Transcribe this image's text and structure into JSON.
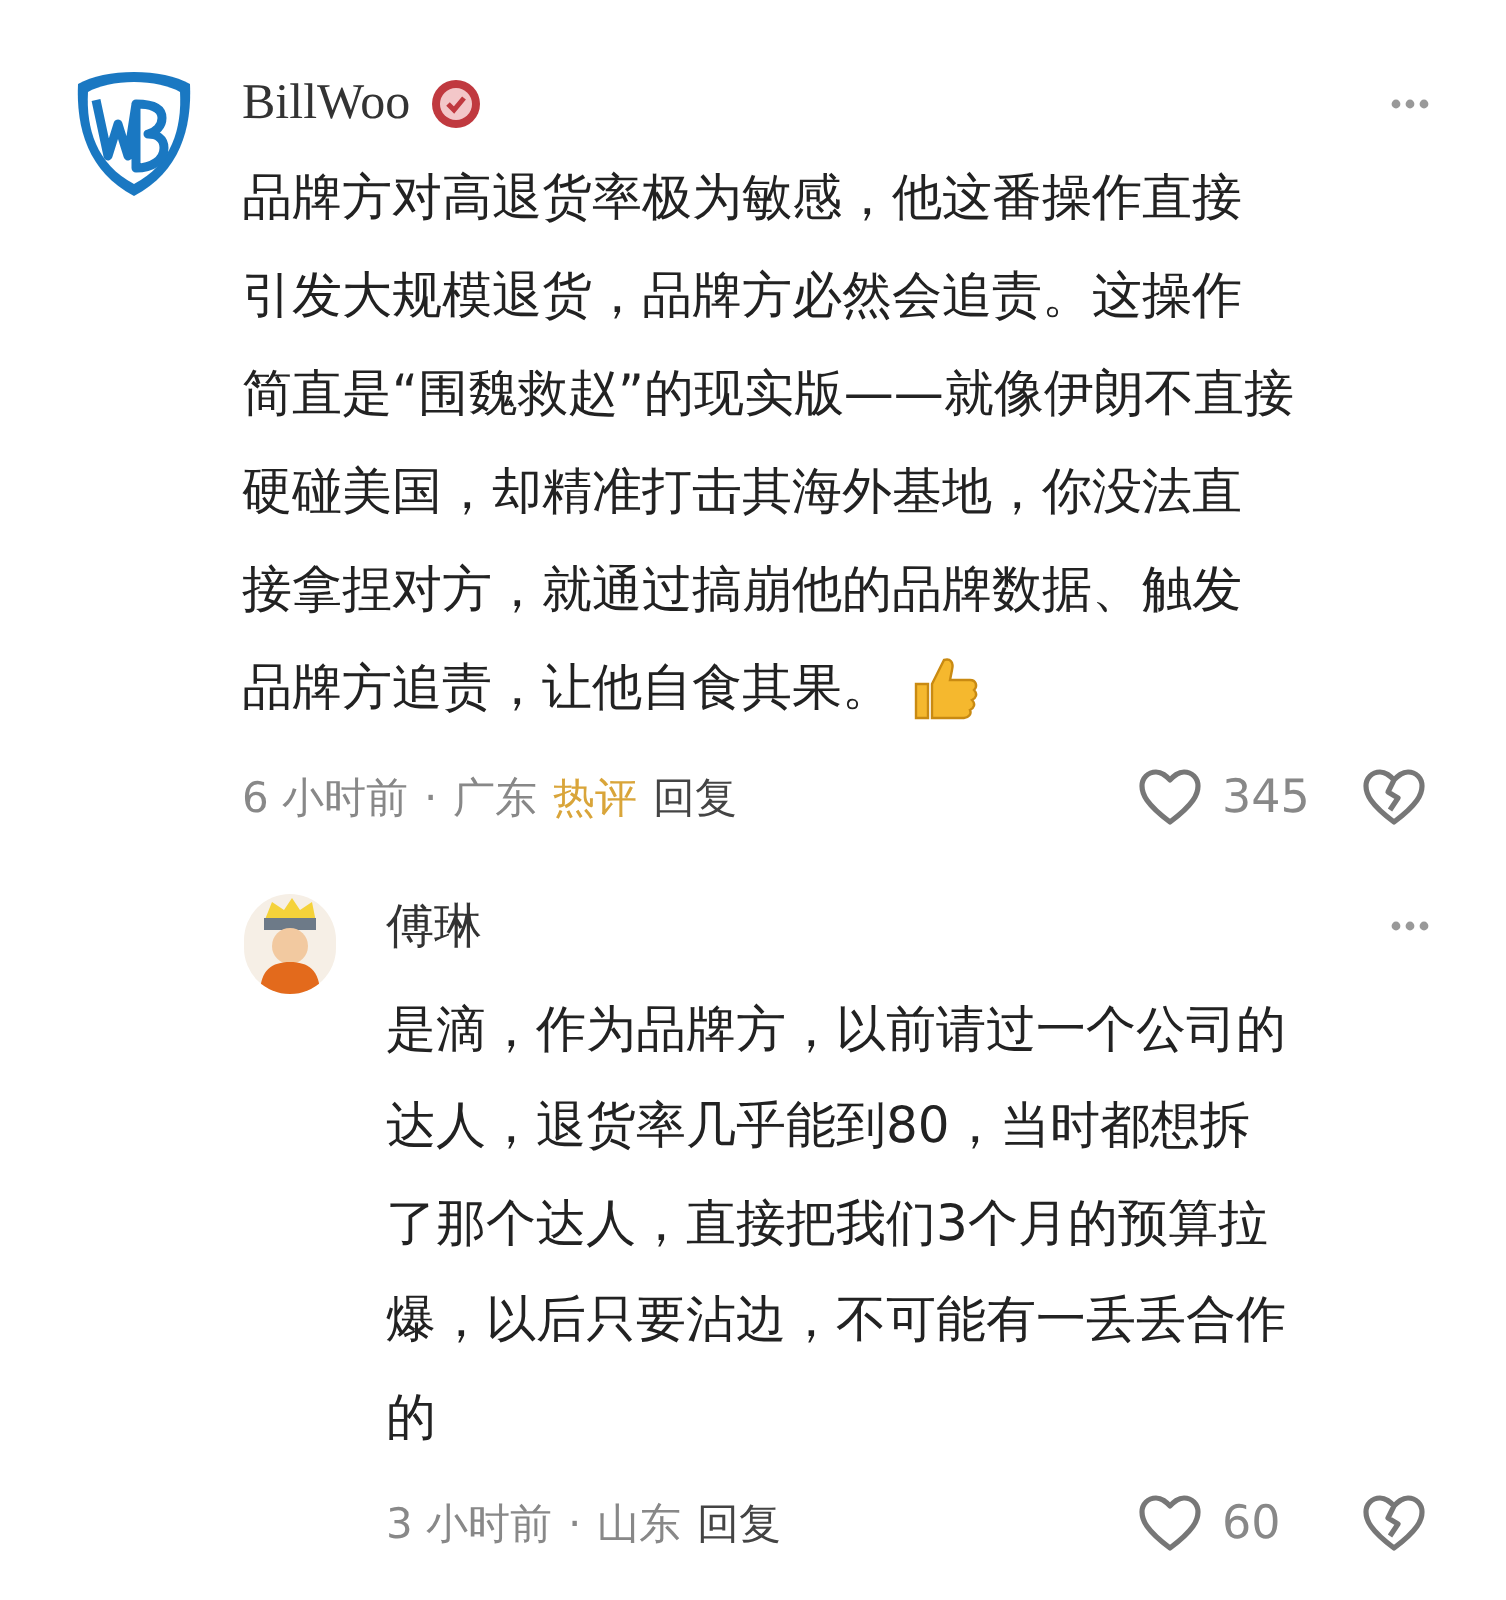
{
  "comment": {
    "author": "BillWoo",
    "verified": true,
    "text_lines": [
      "品牌方对高退货率极为敏感，他这番操作直接",
      "引发大规模退货，品牌方必然会追责。这操作",
      "简直是“围魏救赵”的现实版——就像伊朗不直接",
      "硬碰美国，却精准打击其海外基地，你没法直",
      "接拿捏对方，就通过搞崩他的品牌数据、触发",
      "品牌方追责，让他自食其果。"
    ],
    "time": "6 小时前",
    "separator": "·",
    "location": "广东",
    "hot_label": "热评",
    "reply_label": "回复",
    "likes": "345"
  },
  "reply": {
    "author": "傅琳",
    "text_lines": [
      "是滴，作为品牌方，以前请过一个公司的",
      "达人，退货率几乎能到80，当时都想拆",
      "了那个达人，直接把我们3个月的预算拉",
      "爆，以后只要沾边，不可能有一丢丢合作",
      "的"
    ],
    "time": "3 小时前",
    "separator": "·",
    "location": "山东",
    "reply_label": "回复",
    "likes": "60"
  }
}
